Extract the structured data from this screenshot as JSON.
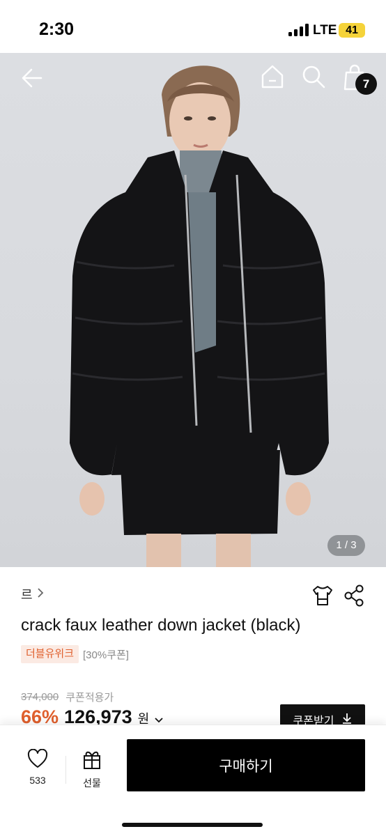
{
  "status_bar": {
    "time": "2:30",
    "network": "LTE",
    "battery": "41",
    "battery_color": "#f5d33a"
  },
  "header": {
    "back_icon": "arrow-left-icon",
    "home_icon": "home-icon",
    "search_icon": "search-icon",
    "cart_icon": "cart-icon",
    "cart_count": "7"
  },
  "gallery": {
    "counter": "1 / 3"
  },
  "product": {
    "brand": "르",
    "title": "crack faux leather down jacket (black)",
    "badge": "더블유위크",
    "coupon_tag": "[30%쿠폰]",
    "original_price": "374,000",
    "coupon_price_label": "쿠폰적용가",
    "discount": "66%",
    "price": "126,973",
    "currency": "원",
    "coupon_button": "쿠폰받기",
    "accent_color": "#e0602e"
  },
  "bottom_bar": {
    "like_count": "533",
    "gift_label": "선물",
    "buy_label": "구매하기"
  }
}
